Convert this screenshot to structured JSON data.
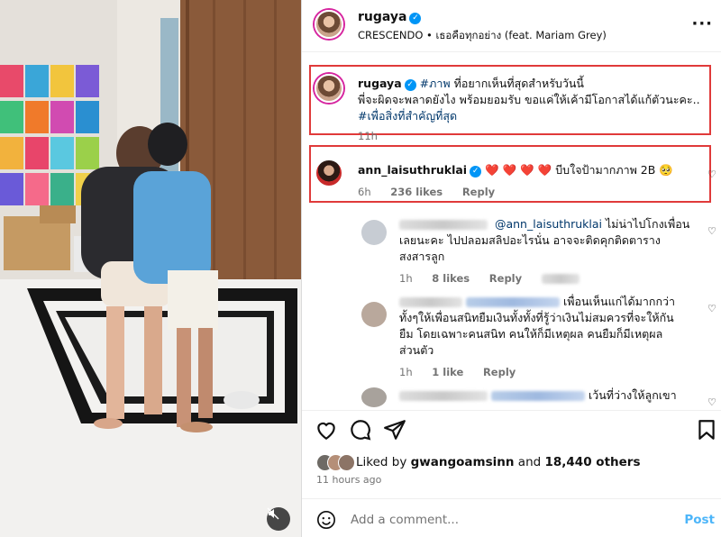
{
  "post": {
    "username": "rugaya",
    "audio": "CRESCENDO • เธอคือทุกอย่าง (feat. Mariam Grey)",
    "more_label": "···"
  },
  "caption": {
    "username": "rugaya",
    "hashtag1": "#ภาพ",
    "line1": "ที่อยากเห็นที่สุดสำหรับวันนี้",
    "line2": "พี่จะผิดจะพลาดยังไง พร้อมยอมรับ ขอแค่ให้เค้ามีโอกาสได้แก้ตัวนะคะ..",
    "hashtag2": "#เพื่อสิ่งที่สำคัญที่สุด",
    "time": "11h"
  },
  "comment1": {
    "username": "ann_laisuthruklai",
    "hearts": "❤️ ❤️ ❤️ ❤️",
    "text": "บีบใจป้ามากภาพ 2B 🥺",
    "time": "6h",
    "likes": "236 likes",
    "reply": "Reply"
  },
  "reply1": {
    "mention": "@ann_laisuthruklai",
    "text1": "ไม่น่าไปโกงเพื่อน",
    "text2": "เลยนะคะ ไปปลอมสลิปอะไรนั่น อาจจะติดคุกติดตาราง",
    "text3": "สงสารลูก",
    "time": "1h",
    "likes": "8 likes",
    "reply": "Reply"
  },
  "reply2": {
    "text1": "เพื่อนเห็นแก่ได้มากกว่า",
    "text2": "ทั้งๆให้เพื่อนสนิทยืมเงินทั้งทั้งที่รู้ว่าเงินไม่สมควรที่จะให้กัน",
    "text3": "ยืม โดยเฉพาะคนสนิท คนให้ก็มีเหตุผล คนยืมก็มีเหตุผล",
    "text4": "ส่วนตัว",
    "time": "1h",
    "likes": "1 like",
    "reply": "Reply"
  },
  "reply3": {
    "text1": "เว้นที่ว่างให้ลูกเขา"
  },
  "footer": {
    "liked_prefix": "Liked by",
    "liked_user": "gwangoamsinn",
    "liked_mid": "and",
    "liked_count": "18,440 others",
    "time_ago": "11 hours ago",
    "add_comment_placeholder": "Add a comment...",
    "post_label": "Post"
  },
  "colors": {
    "accent": "#0095f6",
    "highlight_box": "#e03a3a",
    "heart": "#ed4956"
  }
}
